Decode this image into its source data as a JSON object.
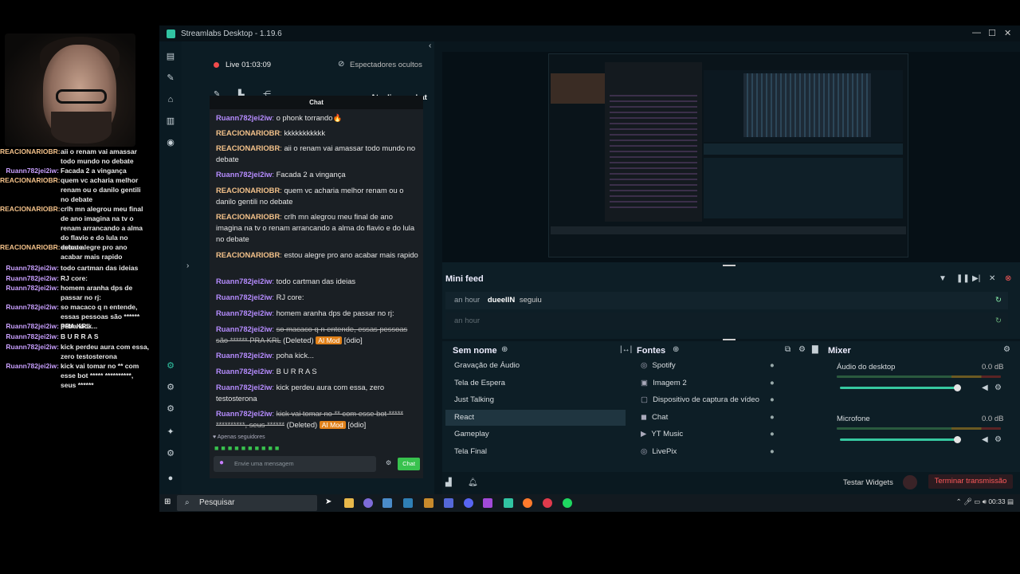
{
  "window": {
    "title": "Streamlabs Desktop - 1.19.6"
  },
  "overlay_chat": [
    {
      "user": "REACIONARIOBR:",
      "text": "aii o renam vai amassar todo mundo no debate",
      "cls": "u-b"
    },
    {
      "user": "Ruann782jei2iw:",
      "text": "Facada 2 a vingança",
      "cls": "u-a"
    },
    {
      "user": "REACIONARIOBR:",
      "text": "quem vc acharia melhor renam ou o danilo gentili no debate",
      "cls": "u-b"
    },
    {
      "user": "REACIONARIOBR:",
      "text": "crlh mn alegrou meu final de ano imagina na tv o renam arrancando a alma do flavio e do lula no debate",
      "cls": "u-b"
    },
    {
      "user": "REACIONARIOBR:",
      "text": "estou alegre pro ano acabar mais rapido",
      "cls": "u-b"
    },
    {
      "user": "Ruann782jei2iw:",
      "text": "todo cartman das ideias",
      "cls": "u-a"
    },
    {
      "user": "Ruann782jei2iw:",
      "text": "RJ core:",
      "cls": "u-a"
    },
    {
      "user": "Ruann782jei2iw:",
      "text": "homem aranha dps de passar no rj:",
      "cls": "u-a"
    },
    {
      "user": "Ruann782jei2iw:",
      "text": "so macaco q n entende, essas pessoas são ****** PRA KRL",
      "cls": "u-a"
    },
    {
      "user": "Ruann782jei2iw:",
      "text": "poha kick...",
      "cls": "u-a"
    },
    {
      "user": "Ruann782jei2iw:",
      "text": "B U R R A S",
      "cls": "u-a"
    },
    {
      "user": "Ruann782jei2iw:",
      "text": "kick perdeu aura com essa, zero testosterona",
      "cls": "u-a"
    },
    {
      "user": "Ruann782jei2iw:",
      "text": "kick vai tomar no ** com esse bot ***** **********, seus ******",
      "cls": "u-a"
    }
  ],
  "chat_panel": {
    "live_label": "Live",
    "live_time": "01:03:09",
    "hidden_viewers": "Espectadores ocultos",
    "refresh_chat": "Atualizar o chat",
    "chat_header": "Chat",
    "followers_only": "Apenas seguidores",
    "input_placeholder": "Envie uma mensagem",
    "send_label": "Chat"
  },
  "chat": [
    {
      "user": "Ruann782jei2iw",
      "text": "o phonk torrando🔥",
      "color": "#b68cff"
    },
    {
      "user": "REACIONARIOBR",
      "text": "kkkkkkkkkkk",
      "color": "#f4c28a"
    },
    {
      "user": "REACIONARIOBR",
      "text": "aii o renam vai amassar todo mundo no debate",
      "color": "#f4c28a"
    },
    {
      "user": "Ruann782jei2iw",
      "text": "Facada 2 a vingança",
      "color": "#b68cff"
    },
    {
      "user": "REACIONARIOBR",
      "text": "quem vc acharia melhor renam ou o danilo gentili no debate",
      "color": "#f4c28a"
    },
    {
      "user": "REACIONARIOBR",
      "text": "crlh mn alegrou meu final de ano imagina na tv o renam arrancando a alma do flavio e do lula no debate",
      "color": "#f4c28a"
    },
    {
      "user": "REACIONARIOBR",
      "text": "estou alegre pro ano acabar mais rapido",
      "color": "#f4c28a"
    },
    {
      "user": "Ruann782jei2iw",
      "text": "todo cartman das ideias",
      "color": "#b68cff"
    },
    {
      "user": "Ruann782jei2iw",
      "text": "RJ core:",
      "color": "#b68cff"
    },
    {
      "user": "Ruann782jei2iw",
      "text": "homem aranha dps de passar no rj:",
      "color": "#b68cff"
    }
  ],
  "chat_deleted_1": {
    "user": "Ruann782jei2iw",
    "text": "so macaco q n entende, essas pessoas são ****** PRA KRL",
    "deleted": "(Deleted)",
    "tag": "AI Mod",
    "reason": "[ódio]"
  },
  "chat_more": [
    {
      "user": "Ruann782jei2iw",
      "text": "poha kick..."
    },
    {
      "user": "Ruann782jei2iw",
      "text": "B U R R A S"
    },
    {
      "user": "Ruann782jei2iw",
      "text": "kick perdeu aura com essa, zero testosterona"
    }
  ],
  "chat_deleted_2": {
    "user": "Ruann782jei2iw",
    "text": "kick vai tomar no ** com esse bot ***** **********, seus ******",
    "deleted": "(Deleted)",
    "tag": "AI Mod",
    "reason": "[ódio]"
  },
  "mini_feed": {
    "title": "Mini feed",
    "rows": [
      {
        "time": "an hour",
        "user": "dueelIN",
        "action": "seguiu"
      },
      {
        "time": "an hour",
        "user": "",
        "action": ""
      }
    ]
  },
  "scenes": {
    "title": "Sem nome",
    "items": [
      "Gravação de Áudio",
      "Tela de Espera",
      "Just Talking",
      "React",
      "Gameplay",
      "Tela Final"
    ],
    "selected_index": 3
  },
  "sources": {
    "title": "Fontes",
    "items": [
      "Spotify",
      "Imagem 2",
      "Dispositivo de captura de vídeo",
      "Chat",
      "YT Music",
      "LivePix"
    ]
  },
  "mixer": {
    "title": "Mixer",
    "channels": [
      {
        "name": "Áudio do desktop",
        "db": "0.0 dB",
        "level": 0.92
      },
      {
        "name": "Microfone",
        "db": "0.0 dB",
        "level": 0.92
      }
    ]
  },
  "footer": {
    "test_widgets": "Testar Widgets",
    "end_stream": "Terminar transmissão"
  },
  "taskbar": {
    "search": "Pesquisar",
    "clock": "00:33"
  },
  "colors": {
    "accent": "#31c3a2",
    "live": "#f24b4b",
    "end": "#ff5a5a"
  }
}
